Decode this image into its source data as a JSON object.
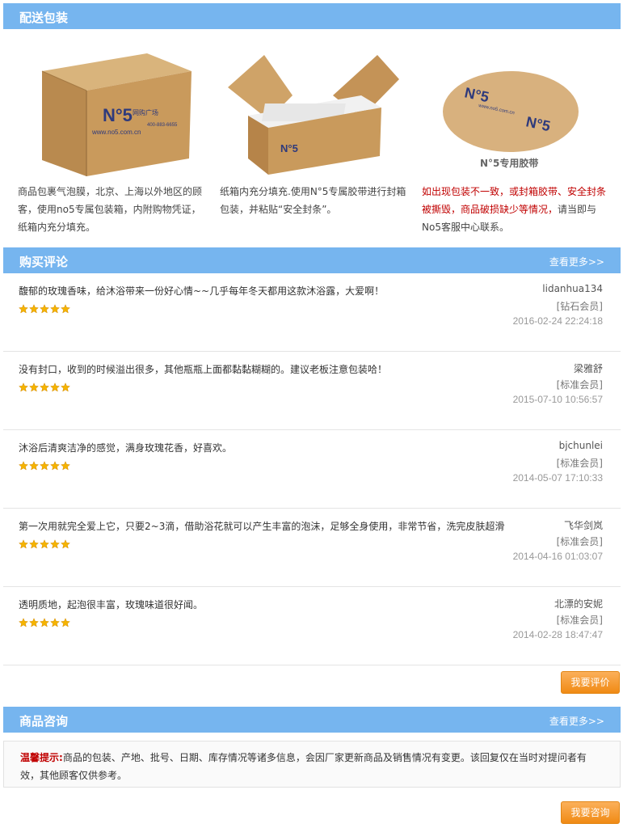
{
  "packaging": {
    "title": "配送包装",
    "box_brand": "N°5",
    "box_brand_sub": "网购广场",
    "box_url": "www.no5.com.cn",
    "box_phone": "400-883-6655",
    "tape_caption": "N°5专用胶带",
    "col1_text": [
      "商品包裹气泡膜，北京、上海以外地区的顾",
      "客，使用no5专属包装箱，内附购物凭证，",
      "纸箱内充分填充。"
    ],
    "col2_text": [
      "纸箱内充分填充.使用N°5专属胶带进行封箱",
      "包装，并粘贴“安全封条”。"
    ],
    "col3_red_1": "如出现包装不一致，或封箱胶带、安全封条",
    "col3_red_2": "被撕毁，商品破损缺少等情况，",
    "col3_normal_2": "请当即与",
    "col3_normal_3": "No5客服中心联系。"
  },
  "reviews": {
    "title": "购买评论",
    "more": "查看更多>>",
    "items": [
      {
        "content": "馥郁的玫瑰香味，给沐浴带来一份好心情~~几乎每年冬天都用这款沐浴露，大爱啊！",
        "stars": 5,
        "user": "lidanhua134",
        "level": "[钻石会员]",
        "time": "2016-02-24 22:24:18"
      },
      {
        "content": "没有封口，收到的时候溢出很多，其他瓶瓶上面都黏黏糊糊的。建议老板注意包装哈！",
        "stars": 5,
        "user": "梁雅舒",
        "level": "[标准会员]",
        "time": "2015-07-10 10:56:57"
      },
      {
        "content": "沐浴后清爽洁净的感觉，满身玫瑰花香，好喜欢。",
        "stars": 5,
        "user": "bjchunlei",
        "level": "[标准会员]",
        "time": "2014-05-07 17:10:33"
      },
      {
        "content": "第一次用就完全爱上它，只要2~3滴，借助浴花就可以产生丰富的泡沫，足够全身使用，非常节省，洗完皮肤超滑",
        "stars": 5,
        "user": "飞华剑岚",
        "level": "[标准会员]",
        "time": "2014-04-16 01:03:07"
      },
      {
        "content": "透明质地，起泡很丰富，玫瑰味道很好闻。",
        "stars": 5,
        "user": "北漂的安妮",
        "level": "[标准会员]",
        "time": "2014-02-28 18:47:47"
      }
    ],
    "button": "我要评价"
  },
  "consult": {
    "title": "商品咨询",
    "more": "查看更多>>",
    "tip_label": "温馨提示:",
    "tip_text_1": "商品的包装、产地、批号、日期、库存情况等诸多信息，会因厂家更新商品及销售情况有变更。该回复仅在当时对提问者有",
    "tip_text_2": "效，其他顾客仅供参考。",
    "button": "我要咨询"
  },
  "colors": {
    "bar": "#76b5ef",
    "accent_red": "#c00000",
    "button_orange": "#f08a14",
    "star": "#f5b400"
  }
}
